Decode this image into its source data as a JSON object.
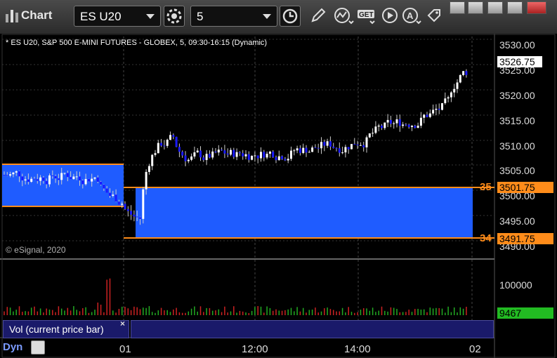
{
  "window": {
    "title": "Chart",
    "symbol_value": "ES U20",
    "interval_value": "5"
  },
  "toolbar": {
    "icons": [
      "settings-gear-icon",
      "clock-icon",
      "pencil-icon",
      "indicator-icon",
      "get-icon",
      "play-icon",
      "a-icon",
      "tag-icon"
    ]
  },
  "chart": {
    "subtitle": "* ES U20, S&P 500 E-MINI FUTURES - GLOBEX, 5, 09:30-16:15 (Dynamic)",
    "copyright": "© eSignal, 2020",
    "price_ticks": [
      "3530.00",
      "3525.00",
      "3520.00",
      "3515.00",
      "3510.00",
      "3505.00",
      "3500.00",
      "3495.00",
      "3490.00"
    ],
    "last_price": "3526.75",
    "upper_level": {
      "value": "3501.75",
      "label": "35"
    },
    "lower_level": {
      "value": "3491.75",
      "label": "34"
    },
    "time_ticks": [
      "01",
      "12:00",
      "14:00",
      "02"
    ],
    "colors": {
      "up_bar": "#ffffff",
      "down_bar": "#1a1aff",
      "zone": "#1f5cff",
      "level": "#ff8c1a",
      "volume_up": "#22aa22",
      "volume_down": "#cc2222"
    }
  },
  "volume": {
    "label": "Vol (current price bar)",
    "close_glyph": "×",
    "tick": "100000",
    "current": "9467"
  },
  "footer": {
    "mode": "Dyn"
  }
}
